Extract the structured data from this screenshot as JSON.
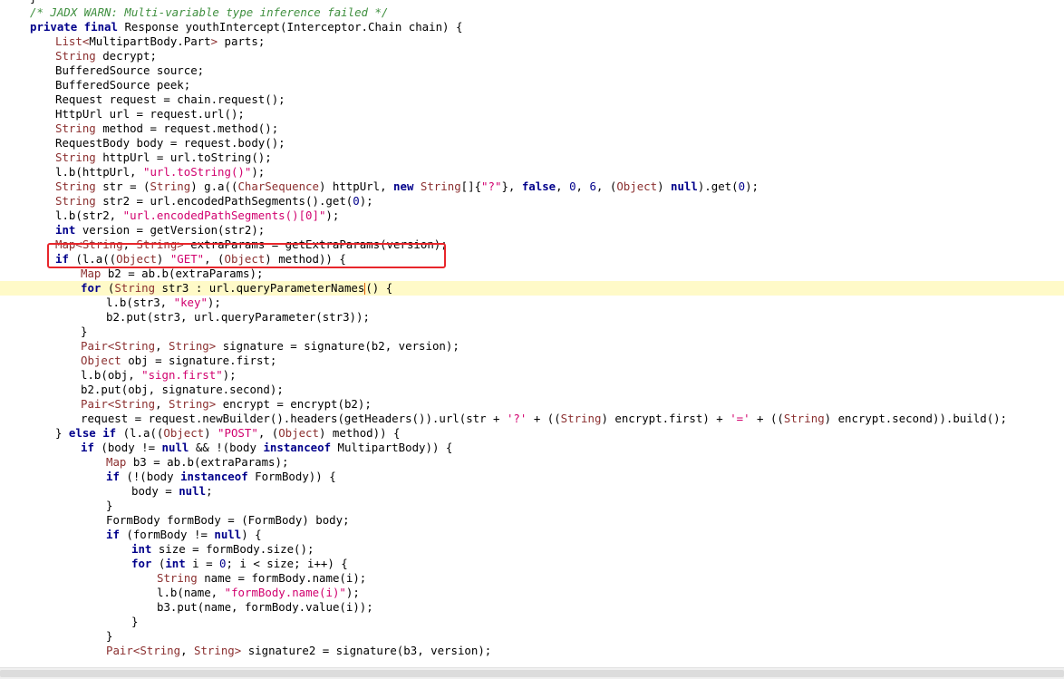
{
  "editor": {
    "current_line_index": 20,
    "highlighted_line_index": 17,
    "lines": [
      {
        "indent": 1,
        "tokens": [
          {
            "t": "}",
            "c": "pl"
          }
        ]
      },
      {
        "indent": 1,
        "tokens": [
          {
            "t": "/* JADX WARN: Multi-variable type inference failed */",
            "c": "cm"
          }
        ]
      },
      {
        "indent": 1,
        "tokens": [
          {
            "t": "private final",
            "c": "kw"
          },
          {
            "t": " Response youthIntercept(Interceptor.Chain chain) {",
            "c": "pl"
          }
        ]
      },
      {
        "indent": 2,
        "tokens": [
          {
            "t": "List<",
            "c": "tp"
          },
          {
            "t": "MultipartBody.Part",
            "c": "pl"
          },
          {
            "t": ">",
            "c": "tp"
          },
          {
            "t": " parts;",
            "c": "pl"
          }
        ]
      },
      {
        "indent": 2,
        "tokens": [
          {
            "t": "String",
            "c": "tp"
          },
          {
            "t": " decrypt;",
            "c": "pl"
          }
        ]
      },
      {
        "indent": 2,
        "tokens": [
          {
            "t": "BufferedSource source;",
            "c": "pl"
          }
        ]
      },
      {
        "indent": 2,
        "tokens": [
          {
            "t": "BufferedSource peek;",
            "c": "pl"
          }
        ]
      },
      {
        "indent": 2,
        "tokens": [
          {
            "t": "Request request = chain.request();",
            "c": "pl"
          }
        ]
      },
      {
        "indent": 2,
        "tokens": [
          {
            "t": "HttpUrl url = request.url();",
            "c": "pl"
          }
        ]
      },
      {
        "indent": 2,
        "tokens": [
          {
            "t": "String",
            "c": "tp"
          },
          {
            "t": " method = request.method();",
            "c": "pl"
          }
        ]
      },
      {
        "indent": 2,
        "tokens": [
          {
            "t": "RequestBody body = request.body();",
            "c": "pl"
          }
        ]
      },
      {
        "indent": 2,
        "tokens": [
          {
            "t": "String",
            "c": "tp"
          },
          {
            "t": " httpUrl = url.toString();",
            "c": "pl"
          }
        ]
      },
      {
        "indent": 2,
        "tokens": [
          {
            "t": "l.b(httpUrl, ",
            "c": "pl"
          },
          {
            "t": "\"url.toString()\"",
            "c": "st"
          },
          {
            "t": ");",
            "c": "pl"
          }
        ]
      },
      {
        "indent": 2,
        "tokens": [
          {
            "t": "String",
            "c": "tp"
          },
          {
            "t": " str = (",
            "c": "pl"
          },
          {
            "t": "String",
            "c": "tp"
          },
          {
            "t": ") g.a((",
            "c": "pl"
          },
          {
            "t": "CharSequence",
            "c": "tp"
          },
          {
            "t": ") httpUrl, ",
            "c": "pl"
          },
          {
            "t": "new",
            "c": "kw"
          },
          {
            "t": " ",
            "c": "pl"
          },
          {
            "t": "String",
            "c": "tp"
          },
          {
            "t": "[]{",
            "c": "pl"
          },
          {
            "t": "\"?\"",
            "c": "st"
          },
          {
            "t": "}, ",
            "c": "pl"
          },
          {
            "t": "false",
            "c": "kw"
          },
          {
            "t": ", ",
            "c": "pl"
          },
          {
            "t": "0",
            "c": "nm"
          },
          {
            "t": ", ",
            "c": "pl"
          },
          {
            "t": "6",
            "c": "nm"
          },
          {
            "t": ", (",
            "c": "pl"
          },
          {
            "t": "Object",
            "c": "tp"
          },
          {
            "t": ") ",
            "c": "pl"
          },
          {
            "t": "null",
            "c": "kw"
          },
          {
            "t": ").get(",
            "c": "pl"
          },
          {
            "t": "0",
            "c": "nm"
          },
          {
            "t": ");",
            "c": "pl"
          }
        ]
      },
      {
        "indent": 2,
        "tokens": [
          {
            "t": "String",
            "c": "tp"
          },
          {
            "t": " str2 = url.encodedPathSegments().get(",
            "c": "pl"
          },
          {
            "t": "0",
            "c": "nm"
          },
          {
            "t": ");",
            "c": "pl"
          }
        ]
      },
      {
        "indent": 2,
        "tokens": [
          {
            "t": "l.b(str2, ",
            "c": "pl"
          },
          {
            "t": "\"url.encodedPathSegments()[0]\"",
            "c": "st"
          },
          {
            "t": ");",
            "c": "pl"
          }
        ]
      },
      {
        "indent": 2,
        "tokens": [
          {
            "t": "int",
            "c": "kw"
          },
          {
            "t": " version = getVersion(str2);",
            "c": "pl"
          }
        ]
      },
      {
        "indent": 2,
        "tokens": [
          {
            "t": "Map<",
            "c": "tp"
          },
          {
            "t": "String",
            "c": "tp"
          },
          {
            "t": ", ",
            "c": "pl"
          },
          {
            "t": "String",
            "c": "tp"
          },
          {
            "t": ">",
            "c": "tp"
          },
          {
            "t": " extraParams = getExtraParams(version);",
            "c": "pl"
          }
        ]
      },
      {
        "indent": 2,
        "tokens": [
          {
            "t": "if",
            "c": "kw"
          },
          {
            "t": " (l.a((",
            "c": "pl"
          },
          {
            "t": "Object",
            "c": "tp"
          },
          {
            "t": ") ",
            "c": "pl"
          },
          {
            "t": "\"GET\"",
            "c": "st"
          },
          {
            "t": ", (",
            "c": "pl"
          },
          {
            "t": "Object",
            "c": "tp"
          },
          {
            "t": ") method)) {",
            "c": "pl"
          }
        ]
      },
      {
        "indent": 3,
        "tokens": [
          {
            "t": "Map",
            "c": "tp"
          },
          {
            "t": " b2 = ab.b(extraParams);",
            "c": "pl"
          }
        ]
      },
      {
        "indent": 3,
        "tokens": [
          {
            "t": "for",
            "c": "kw"
          },
          {
            "t": " (",
            "c": "pl"
          },
          {
            "t": "String",
            "c": "tp"
          },
          {
            "t": " str3 : url.queryParameterNames",
            "c": "pl"
          },
          {
            "t": "CARET",
            "c": "caret"
          },
          {
            "t": "() {",
            "c": "pl"
          }
        ]
      },
      {
        "indent": 4,
        "tokens": [
          {
            "t": "l.b(str3, ",
            "c": "pl"
          },
          {
            "t": "\"key\"",
            "c": "st"
          },
          {
            "t": ");",
            "c": "pl"
          }
        ]
      },
      {
        "indent": 4,
        "tokens": [
          {
            "t": "b2.put(str3, url.queryParameter(str3));",
            "c": "pl"
          }
        ]
      },
      {
        "indent": 3,
        "tokens": [
          {
            "t": "}",
            "c": "pl"
          }
        ]
      },
      {
        "indent": 3,
        "tokens": [
          {
            "t": "Pair<",
            "c": "tp"
          },
          {
            "t": "String",
            "c": "tp"
          },
          {
            "t": ", ",
            "c": "pl"
          },
          {
            "t": "String",
            "c": "tp"
          },
          {
            "t": ">",
            "c": "tp"
          },
          {
            "t": " signature = signature(b2, version);",
            "c": "pl"
          }
        ]
      },
      {
        "indent": 3,
        "tokens": [
          {
            "t": "Object",
            "c": "tp"
          },
          {
            "t": " obj = signature.first;",
            "c": "pl"
          }
        ]
      },
      {
        "indent": 3,
        "tokens": [
          {
            "t": "l.b(obj, ",
            "c": "pl"
          },
          {
            "t": "\"sign.first\"",
            "c": "st"
          },
          {
            "t": ");",
            "c": "pl"
          }
        ]
      },
      {
        "indent": 3,
        "tokens": [
          {
            "t": "b2.put(obj, signature.second);",
            "c": "pl"
          }
        ]
      },
      {
        "indent": 3,
        "tokens": [
          {
            "t": "Pair<",
            "c": "tp"
          },
          {
            "t": "String",
            "c": "tp"
          },
          {
            "t": ", ",
            "c": "pl"
          },
          {
            "t": "String",
            "c": "tp"
          },
          {
            "t": ">",
            "c": "tp"
          },
          {
            "t": " encrypt = encrypt(b2);",
            "c": "pl"
          }
        ]
      },
      {
        "indent": 3,
        "tokens": [
          {
            "t": "request = request.newBuilder().headers(getHeaders()).url(str + ",
            "c": "pl"
          },
          {
            "t": "'?'",
            "c": "st"
          },
          {
            "t": " + ((",
            "c": "pl"
          },
          {
            "t": "String",
            "c": "tp"
          },
          {
            "t": ") encrypt.first) + ",
            "c": "pl"
          },
          {
            "t": "'='",
            "c": "st"
          },
          {
            "t": " + ((",
            "c": "pl"
          },
          {
            "t": "String",
            "c": "tp"
          },
          {
            "t": ") encrypt.second)).build();",
            "c": "pl"
          }
        ]
      },
      {
        "indent": 2,
        "tokens": [
          {
            "t": "} ",
            "c": "pl"
          },
          {
            "t": "else if",
            "c": "kw"
          },
          {
            "t": " (l.a((",
            "c": "pl"
          },
          {
            "t": "Object",
            "c": "tp"
          },
          {
            "t": ") ",
            "c": "pl"
          },
          {
            "t": "\"POST\"",
            "c": "st"
          },
          {
            "t": ", (",
            "c": "pl"
          },
          {
            "t": "Object",
            "c": "tp"
          },
          {
            "t": ") method)) {",
            "c": "pl"
          }
        ]
      },
      {
        "indent": 3,
        "tokens": [
          {
            "t": "if",
            "c": "kw"
          },
          {
            "t": " (body != ",
            "c": "pl"
          },
          {
            "t": "null",
            "c": "kw"
          },
          {
            "t": " && !(body ",
            "c": "pl"
          },
          {
            "t": "instanceof",
            "c": "kw"
          },
          {
            "t": " MultipartBody)) {",
            "c": "pl"
          }
        ]
      },
      {
        "indent": 4,
        "tokens": [
          {
            "t": "Map",
            "c": "tp"
          },
          {
            "t": " b3 = ab.b(extraParams);",
            "c": "pl"
          }
        ]
      },
      {
        "indent": 4,
        "tokens": [
          {
            "t": "if",
            "c": "kw"
          },
          {
            "t": " (!(body ",
            "c": "pl"
          },
          {
            "t": "instanceof",
            "c": "kw"
          },
          {
            "t": " FormBody)) {",
            "c": "pl"
          }
        ]
      },
      {
        "indent": 5,
        "tokens": [
          {
            "t": "body = ",
            "c": "pl"
          },
          {
            "t": "null",
            "c": "kw"
          },
          {
            "t": ";",
            "c": "pl"
          }
        ]
      },
      {
        "indent": 4,
        "tokens": [
          {
            "t": "}",
            "c": "pl"
          }
        ]
      },
      {
        "indent": 4,
        "tokens": [
          {
            "t": "FormBody formBody = (FormBody) body;",
            "c": "pl"
          }
        ]
      },
      {
        "indent": 4,
        "tokens": [
          {
            "t": "if",
            "c": "kw"
          },
          {
            "t": " (formBody != ",
            "c": "pl"
          },
          {
            "t": "null",
            "c": "kw"
          },
          {
            "t": ") {",
            "c": "pl"
          }
        ]
      },
      {
        "indent": 5,
        "tokens": [
          {
            "t": "int",
            "c": "kw"
          },
          {
            "t": " size = formBody.size();",
            "c": "pl"
          }
        ]
      },
      {
        "indent": 5,
        "tokens": [
          {
            "t": "for",
            "c": "kw"
          },
          {
            "t": " (",
            "c": "pl"
          },
          {
            "t": "int",
            "c": "kw"
          },
          {
            "t": " i = ",
            "c": "pl"
          },
          {
            "t": "0",
            "c": "nm"
          },
          {
            "t": "; i < size; i++) {",
            "c": "pl"
          }
        ]
      },
      {
        "indent": 6,
        "tokens": [
          {
            "t": "String",
            "c": "tp"
          },
          {
            "t": " name = formBody.name(i);",
            "c": "pl"
          }
        ]
      },
      {
        "indent": 6,
        "tokens": [
          {
            "t": "l.b(name, ",
            "c": "pl"
          },
          {
            "t": "\"formBody.name(i)\"",
            "c": "st"
          },
          {
            "t": ");",
            "c": "pl"
          }
        ]
      },
      {
        "indent": 6,
        "tokens": [
          {
            "t": "b3.put(name, formBody.value(i));",
            "c": "pl"
          }
        ]
      },
      {
        "indent": 5,
        "tokens": [
          {
            "t": "}",
            "c": "pl"
          }
        ]
      },
      {
        "indent": 4,
        "tokens": [
          {
            "t": "}",
            "c": "pl"
          }
        ]
      },
      {
        "indent": 4,
        "tokens": [
          {
            "t": "Pair<",
            "c": "tp"
          },
          {
            "t": "String",
            "c": "tp"
          },
          {
            "t": ", ",
            "c": "pl"
          },
          {
            "t": "String",
            "c": "tp"
          },
          {
            "t": ">",
            "c": "tp"
          },
          {
            "t": " signature2 = signature(b3, version);",
            "c": "pl"
          }
        ]
      }
    ]
  }
}
